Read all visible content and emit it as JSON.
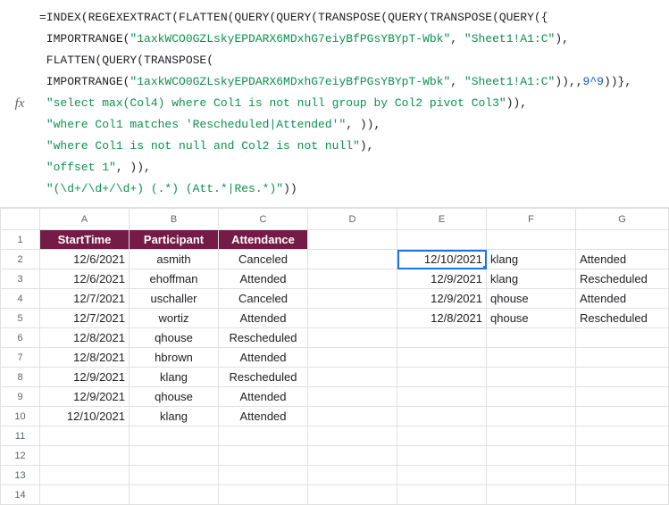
{
  "formula_bar": {
    "fx_label": "fx",
    "lines": [
      [
        {
          "t": "=INDEX(REGEXEXTRACT(FLATTEN(QUERY(QUERY(TRANSPOSE(QUERY(TRANSPOSE(QUERY({",
          "cls": "f-fn"
        }
      ],
      [
        {
          "t": " IMPORTRANGE(",
          "cls": "f-fn"
        },
        {
          "t": "\"1axkWCO0GZLskyEPDARX6MDxhG7eiyBfPGsYBYpT-Wbk\"",
          "cls": "f-str"
        },
        {
          "t": ", ",
          "cls": "f-fn"
        },
        {
          "t": "\"Sheet1!A1:C\"",
          "cls": "f-str"
        },
        {
          "t": "),",
          "cls": "f-fn"
        }
      ],
      [
        {
          "t": " FLATTEN(QUERY(TRANSPOSE(",
          "cls": "f-fn"
        }
      ],
      [
        {
          "t": " IMPORTRANGE(",
          "cls": "f-fn"
        },
        {
          "t": "\"1axkWCO0GZLskyEPDARX6MDxhG7eiyBfPGsYBYpT-Wbk\"",
          "cls": "f-str"
        },
        {
          "t": ", ",
          "cls": "f-fn"
        },
        {
          "t": "\"Sheet1!A1:C\"",
          "cls": "f-str"
        },
        {
          "t": ")),,",
          "cls": "f-fn"
        },
        {
          "t": "9^9",
          "cls": "f-num"
        },
        {
          "t": "))},",
          "cls": "f-fn"
        }
      ],
      [
        {
          "t": " ",
          "cls": "f-fn"
        },
        {
          "t": "\"select max(Col4) where Col1 is not null group by Col2 pivot Col3\"",
          "cls": "f-str"
        },
        {
          "t": ")),",
          "cls": "f-fn"
        }
      ],
      [
        {
          "t": " ",
          "cls": "f-fn"
        },
        {
          "t": "\"where Col1 matches 'Rescheduled|Attended'\"",
          "cls": "f-str"
        },
        {
          "t": ", )),",
          "cls": "f-fn"
        }
      ],
      [
        {
          "t": " ",
          "cls": "f-fn"
        },
        {
          "t": "\"where Col1 is not null and Col2 is not null\"",
          "cls": "f-str"
        },
        {
          "t": "),",
          "cls": "f-fn"
        }
      ],
      [
        {
          "t": " ",
          "cls": "f-fn"
        },
        {
          "t": "\"offset 1\"",
          "cls": "f-str"
        },
        {
          "t": ", )),",
          "cls": "f-fn"
        }
      ],
      [
        {
          "t": " ",
          "cls": "f-fn"
        },
        {
          "t": "\"(\\d+/\\d+/\\d+) (.*) (Att.*|Res.*)\"",
          "cls": "f-str"
        },
        {
          "t": "))",
          "cls": "f-fn"
        }
      ]
    ]
  },
  "columns": [
    "A",
    "B",
    "C",
    "D",
    "E",
    "F",
    "G"
  ],
  "header_row": {
    "col1": "StartTime",
    "col2": "Participant",
    "col3": "Attendance"
  },
  "left_rows": [
    {
      "a": "12/6/2021",
      "b": "asmith",
      "c": "Canceled"
    },
    {
      "a": "12/6/2021",
      "b": "ehoffman",
      "c": "Attended"
    },
    {
      "a": "12/7/2021",
      "b": "uschaller",
      "c": "Canceled"
    },
    {
      "a": "12/7/2021",
      "b": "wortiz",
      "c": "Attended"
    },
    {
      "a": "12/8/2021",
      "b": "qhouse",
      "c": "Rescheduled"
    },
    {
      "a": "12/8/2021",
      "b": "hbrown",
      "c": "Attended"
    },
    {
      "a": "12/9/2021",
      "b": "klang",
      "c": "Rescheduled"
    },
    {
      "a": "12/9/2021",
      "b": "qhouse",
      "c": "Attended"
    },
    {
      "a": "12/10/2021",
      "b": "klang",
      "c": "Attended"
    }
  ],
  "right_rows": [
    {
      "e": "12/10/2021",
      "f": "klang",
      "g": "Attended"
    },
    {
      "e": "12/9/2021",
      "f": "klang",
      "g": "Rescheduled"
    },
    {
      "e": "12/9/2021",
      "f": "qhouse",
      "g": "Attended"
    },
    {
      "e": "12/8/2021",
      "f": "qhouse",
      "g": "Rescheduled"
    }
  ],
  "row_count": 14,
  "selected_cell": {
    "row": 2,
    "col": "E"
  }
}
